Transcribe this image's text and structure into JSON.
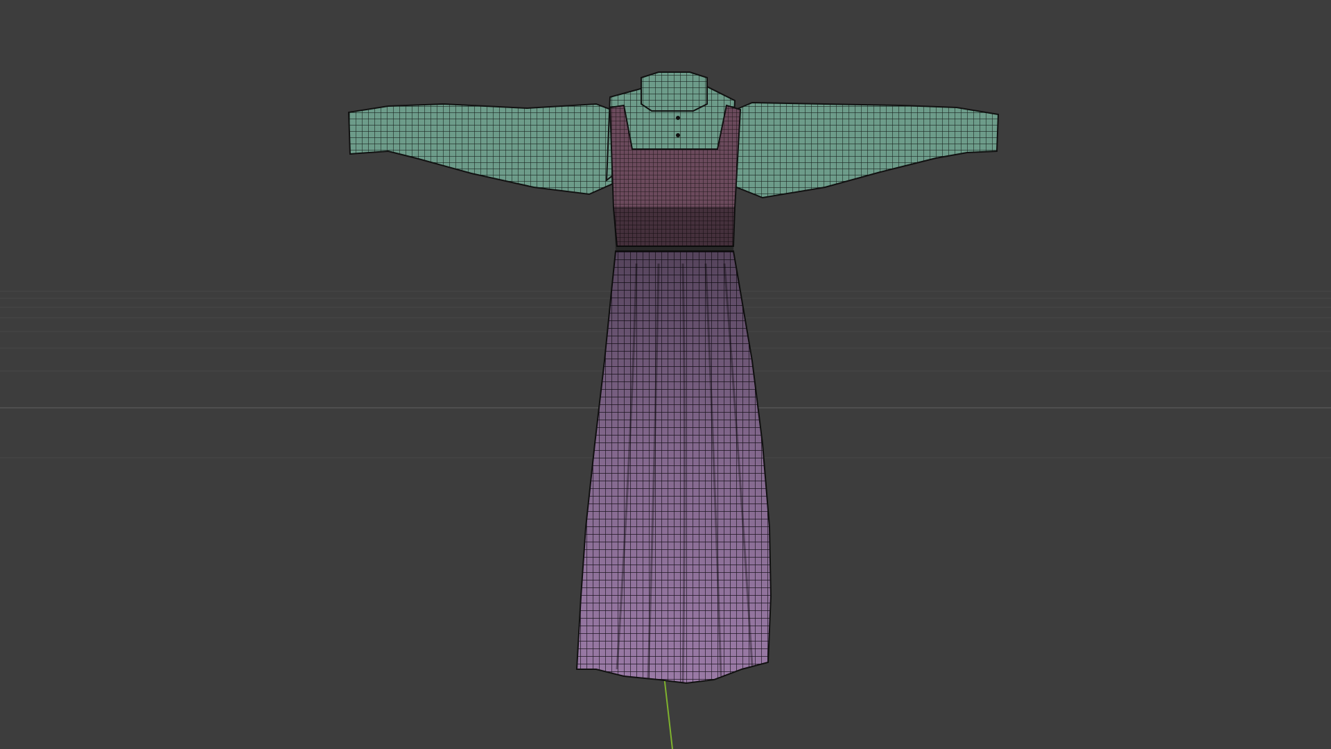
{
  "viewport": {
    "background_color": "#3d3d3d",
    "grid_color": "#474747",
    "horizon_line_color": "#4f4f4f",
    "y_axis_color": "#7fb22e",
    "shading_mode": "wireframe-overlay",
    "objects": [
      {
        "name": "shirt",
        "color": "#6d9c8a",
        "wire_color": "#1a2420"
      },
      {
        "name": "bodice",
        "color": "#6b4a5c",
        "wire_color": "#1c1418"
      },
      {
        "name": "skirt",
        "color": "#9a7aa6",
        "wire_color": "#1e1622"
      }
    ]
  }
}
